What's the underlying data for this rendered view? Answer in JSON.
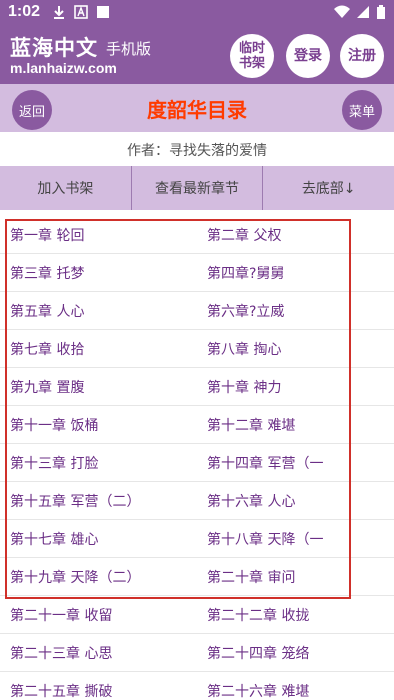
{
  "status_bar": {
    "time": "1:02",
    "left_icons": [
      "download-icon",
      "notification-a-icon",
      "square-icon"
    ],
    "right_icons": [
      "wifi-icon",
      "signal-icon",
      "battery-icon"
    ]
  },
  "header": {
    "site_name": "蓝海中文",
    "site_sub": "手机版",
    "site_url": "m.lanhaizw.com",
    "shelf_line1": "临时",
    "shelf_line2": "书架",
    "login_label": "登录",
    "register_label": "注册"
  },
  "titlebar": {
    "back_label": "返回",
    "title": "度韶华目录",
    "menu_label": "菜单"
  },
  "author": "作者：寻找失落的爱情",
  "actions": {
    "add_shelf": "加入书架",
    "latest": "查看最新章节",
    "to_bottom": "去底部↓"
  },
  "chapters": [
    [
      "第一章 轮回",
      "第二章 父权"
    ],
    [
      "第三章 托梦",
      "第四章?舅舅"
    ],
    [
      "第五章 人心",
      "第六章?立威"
    ],
    [
      "第七章 收拾",
      "第八章 掏心"
    ],
    [
      "第九章 置腹",
      "第十章 神力"
    ],
    [
      "第十一章 饭桶",
      "第十二章 难堪"
    ],
    [
      "第十三章 打脸",
      "第十四章 军营（一"
    ],
    [
      "第十五章 军营（二）",
      "第十六章 人心"
    ],
    [
      "第十七章 雄心",
      "第十八章 天降（一"
    ],
    [
      "第十九章 天降（二）",
      "第二十章 审问"
    ],
    [
      "第二十一章 收留",
      "第二十二章 收拢"
    ],
    [
      "第二十三章 心思",
      "第二十四章 笼络"
    ],
    [
      "第二十五章 撕破",
      "第二十六章 难堪"
    ]
  ],
  "colors": {
    "brand": "#8a5aa0",
    "title_bg": "#d3bcdf",
    "title_text": "#ff3b00",
    "link": "#6b2f86",
    "highlight": "#d0302a"
  }
}
